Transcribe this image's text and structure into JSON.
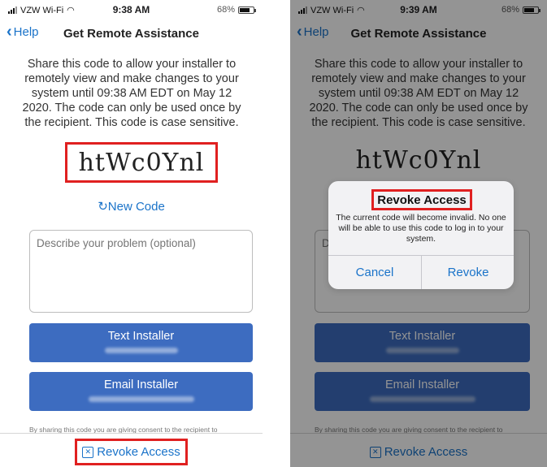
{
  "left": {
    "status": {
      "carrier": "VZW Wi-Fi",
      "time": "9:38 AM",
      "battery": "68%"
    },
    "nav": {
      "back_label": "Help",
      "title": "Get Remote Assistance"
    },
    "description": "Share this code to allow your installer to remotely view and make changes to your system until 09:38 AM EDT on May 12 2020. The code can only be used once by the recipient. This code is case sensitive.",
    "code": "htWc0Ynl",
    "new_code_label": "New Code",
    "problem_placeholder": "Describe your problem (optional)",
    "text_installer_label": "Text Installer",
    "email_installer_label": "Email Installer",
    "consent_text": "By sharing this code you are giving consent to the recipient to",
    "revoke_label": "Revoke Access"
  },
  "right": {
    "status": {
      "carrier": "VZW Wi-Fi",
      "time": "9:39 AM",
      "battery": "68%"
    },
    "nav": {
      "back_label": "Help",
      "title": "Get Remote Assistance"
    },
    "description": "Share this code to allow your installer to remotely view and make changes to your system until 09:38 AM EDT on May 12 2020. The code can only be used once by the recipient. This code is case sensitive.",
    "code": "htWc0Ynl",
    "problem_placeholder": "Describe your problem (optional)",
    "text_installer_label": "Text Installer",
    "email_installer_label": "Email Installer",
    "consent_text": "By sharing this code you are giving consent to the recipient to",
    "revoke_label": "Revoke Access",
    "alert": {
      "title": "Revoke Access",
      "message": "The current code will become invalid. No one will be able to use this code to log in to your system.",
      "cancel_label": "Cancel",
      "revoke_label": "Revoke"
    }
  },
  "colors": {
    "accent": "#1a73c9",
    "button": "#3d6cc0",
    "highlight": "#e02020"
  },
  "icons": {
    "back": "chevron-left-icon",
    "refresh": "refresh-icon",
    "revoke": "revoke-lock-icon",
    "wifi": "wifi-icon",
    "signal": "signal-icon",
    "battery": "battery-icon"
  },
  "battery_level": 0.68
}
